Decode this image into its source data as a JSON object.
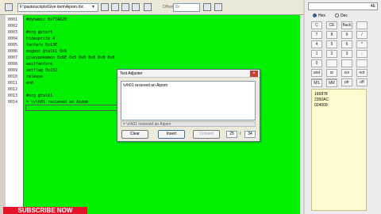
{
  "toolbar": {
    "path": "F:\\pasta\\scripts\\Give item\\Aipom.rbc",
    "offset_label": "Offset:",
    "offset_value": "0x"
  },
  "editor": {
    "line_numbers": [
      "0001",
      "0002",
      "0003",
      "0004",
      "0005",
      "0006",
      "0007",
      "0008",
      "0009",
      "0010",
      "0011",
      "0012",
      "0013",
      "0014"
    ],
    "lines": [
      "#dynamic 0x71A620",
      "",
      "#org @start",
      "hidesprite 4",
      "fanfare 0x13E",
      "msgbox @talk1 0x6",
      "giveypokemon 0x6E 0x5 0x0 0x0 0x0 0x0",
      "waitfanfare",
      "setflag 0x232",
      "release",
      "end",
      "",
      "#org @talk1",
      "= \\v\\h01 recieved an Aipom"
    ]
  },
  "dialog": {
    "title": "Text Adjuster",
    "close_label": "×",
    "text": "\\v\\h01 recieved an Aipom",
    "preview": "= \\v\\h01 recieved an Aipom",
    "clear_label": "Clear",
    "insert_label": "Insert",
    "convert_label": "Convert",
    "count_a": "25",
    "slash": "/",
    "count_b": "34"
  },
  "calculator": {
    "display": "4E",
    "hex_label": "Hex",
    "dec_label": "Dec",
    "keys": [
      [
        "C",
        "CE",
        "Back",
        ""
      ],
      [
        "7",
        "8",
        "9",
        "/"
      ],
      [
        "4",
        "5",
        "6",
        "*"
      ],
      [
        "1",
        "2",
        "3",
        "-"
      ],
      [
        "0",
        "",
        "",
        ""
      ],
      [
        "and",
        "or",
        "xor",
        "not"
      ],
      [
        "lsh",
        "rsh",
        "ptr",
        "off"
      ],
      [
        "hlt",
        "inv",
        "rev",
        ""
      ],
      [
        "MS",
        "MR",
        "",
        ""
      ]
    ],
    "memo": [
      "166878",
      "2350AC",
      "024009"
    ]
  },
  "overlay": {
    "subscribe": "SUBSCRIBE NOW"
  }
}
